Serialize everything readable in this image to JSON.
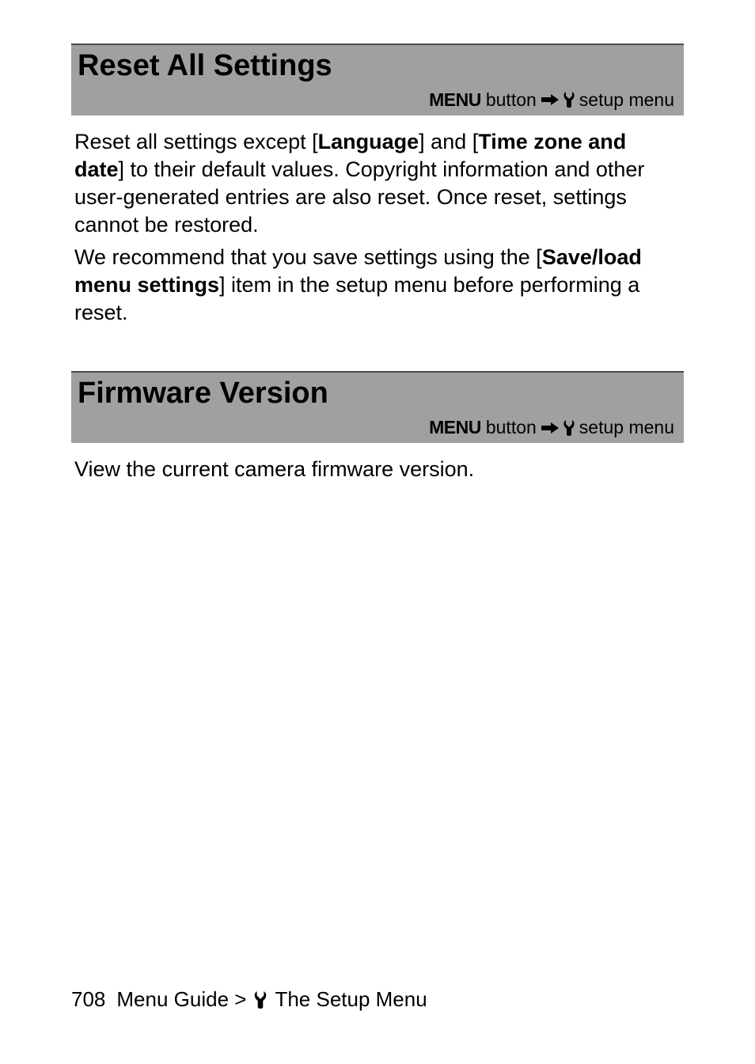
{
  "sections": [
    {
      "title": "Reset All Settings",
      "breadcrumb": {
        "menu": "MENU",
        "button": "button",
        "target": "setup menu"
      },
      "body_html": "Reset all settings except [<b>Language</b>] and [<b>Time zone and date</b>] to their default values. Copyright information and other user-generated entries are also reset. Once reset, settings cannot be restored.",
      "body2_html": "We recommend that you save settings using the [<b>Save/load menu settings</b>] item in the setup menu before performing a reset."
    },
    {
      "title": "Firmware Version",
      "breadcrumb": {
        "menu": "MENU",
        "button": "button",
        "target": "setup menu"
      },
      "body_html": "View the current camera firmware version."
    }
  ],
  "footer": {
    "page": "708",
    "path_prefix": "Menu Guide >",
    "path_suffix": "The Setup Menu"
  }
}
